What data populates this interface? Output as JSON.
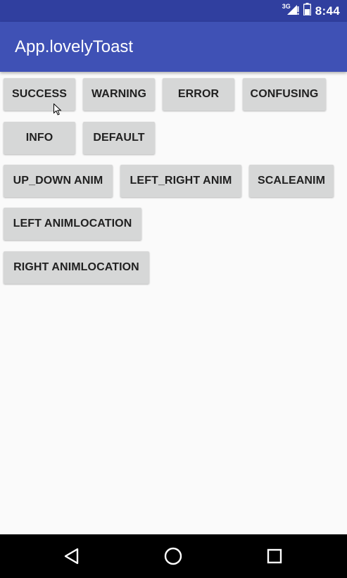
{
  "status_bar": {
    "network_type": "3G",
    "time": "8:44"
  },
  "app_bar": {
    "title": "App.lovelyToast"
  },
  "buttons": {
    "success": "SUCCESS",
    "warning": "WARNING",
    "error": "ERROR",
    "confusing": "CONFUSING",
    "info": "INFO",
    "default": "DEFAULT",
    "up_down_anim": "UP_DOWN ANIM",
    "left_right_anim": "LEFT_RIGHT ANIM",
    "scale_anim": "SCALEANIM",
    "left_anim_location": "LEFT ANIMLOCATION",
    "right_anim_location": "RIGHT ANIMLOCATION"
  },
  "icons": {
    "signal": "signal-strength-icon",
    "battery": "battery-icon",
    "cursor": "mouse-pointer-icon",
    "back": "back-triangle-icon",
    "home": "home-circle-icon",
    "recents": "recents-square-icon"
  },
  "colors": {
    "status_bar": "#303f9f",
    "app_bar": "#3f51b5",
    "background": "#fafafa",
    "button": "#d6d7d7",
    "nav_bar": "#000000"
  }
}
